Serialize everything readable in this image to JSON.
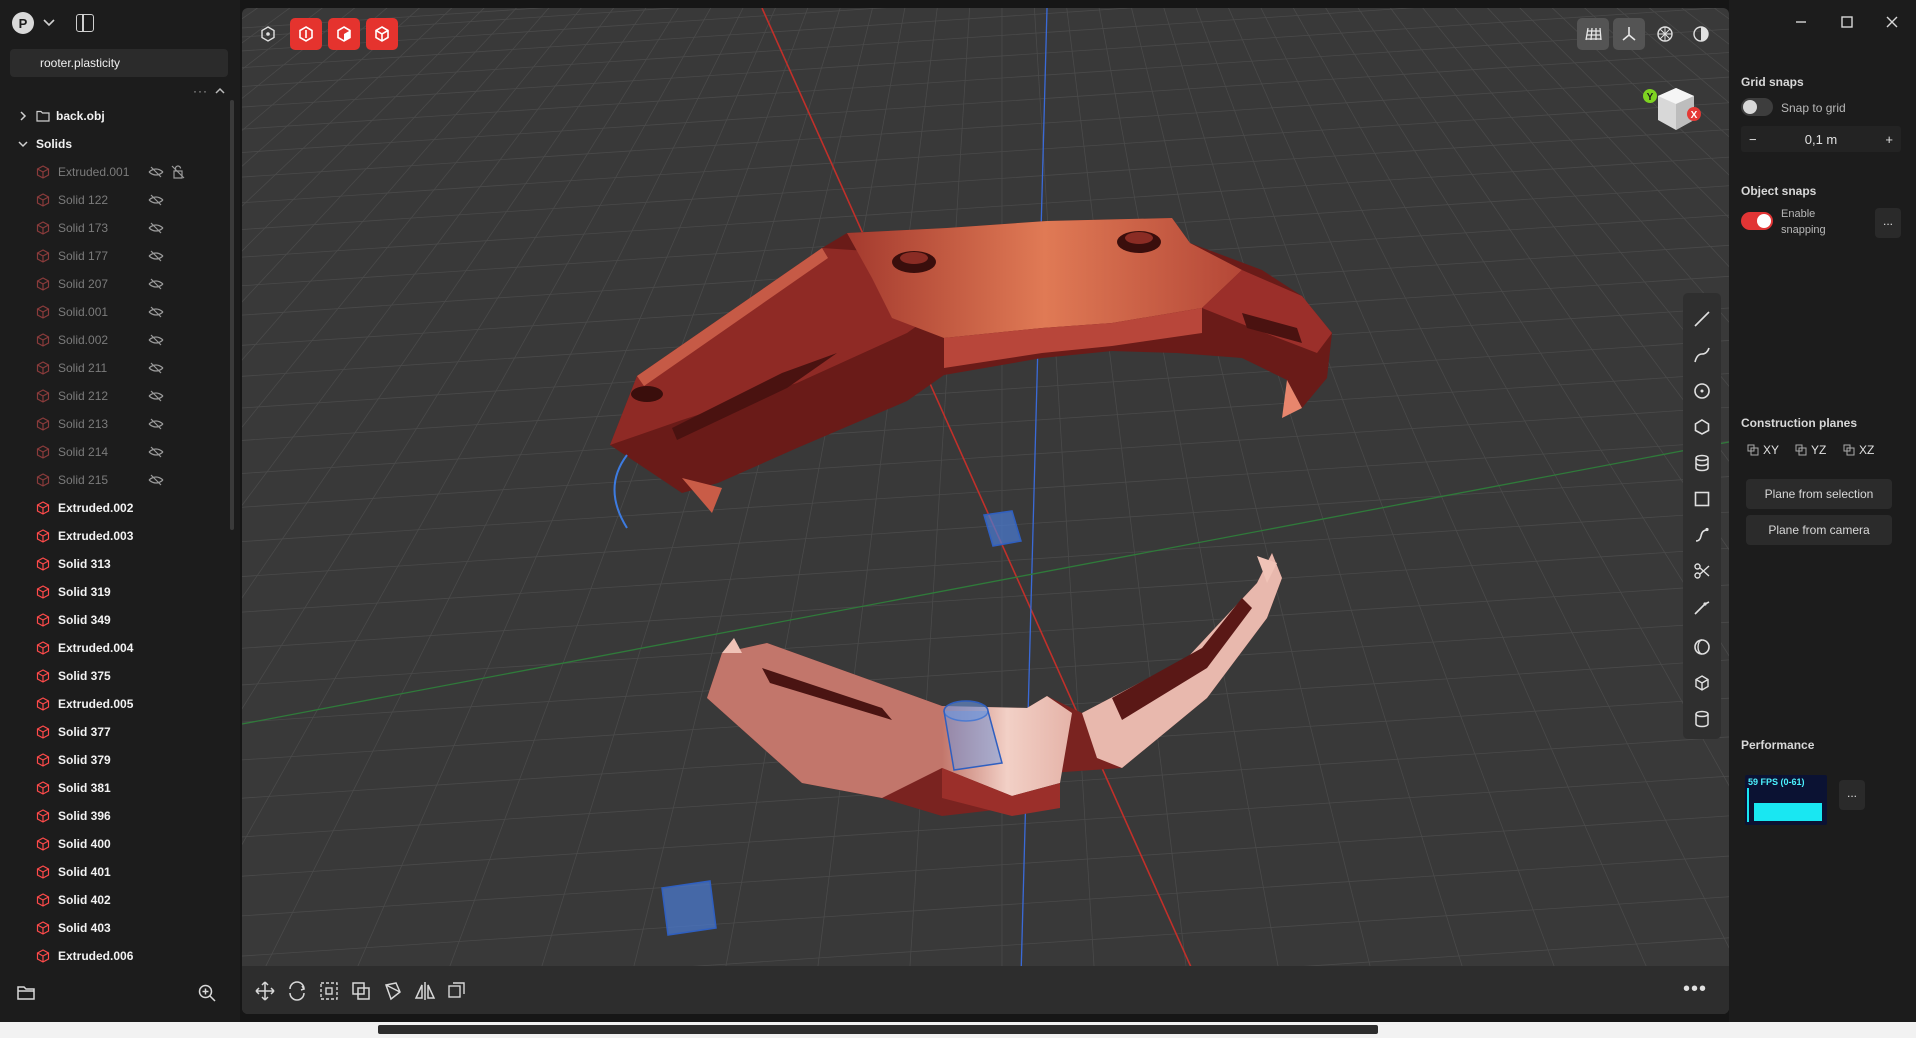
{
  "app": {
    "avatar_letter": "P",
    "file_name": "rooter.plasticity",
    "tree_more": "···"
  },
  "outliner": {
    "items": [
      {
        "label": "back.obj",
        "kind": "folder"
      },
      {
        "label": "Solids",
        "kind": "group"
      },
      {
        "label": "Extruded.001",
        "kind": "hidden-locked"
      },
      {
        "label": "Solid 122",
        "kind": "hidden"
      },
      {
        "label": "Solid 173",
        "kind": "hidden"
      },
      {
        "label": "Solid 177",
        "kind": "hidden"
      },
      {
        "label": "Solid 207",
        "kind": "hidden"
      },
      {
        "label": "Solid.001",
        "kind": "hidden"
      },
      {
        "label": "Solid.002",
        "kind": "hidden"
      },
      {
        "label": "Solid 211",
        "kind": "hidden"
      },
      {
        "label": "Solid 212",
        "kind": "hidden"
      },
      {
        "label": "Solid 213",
        "kind": "hidden"
      },
      {
        "label": "Solid 214",
        "kind": "hidden"
      },
      {
        "label": "Solid 215",
        "kind": "hidden"
      },
      {
        "label": "Extruded.002",
        "kind": "visible"
      },
      {
        "label": "Extruded.003",
        "kind": "visible"
      },
      {
        "label": "Solid 313",
        "kind": "visible"
      },
      {
        "label": "Solid 319",
        "kind": "visible"
      },
      {
        "label": "Solid 349",
        "kind": "visible"
      },
      {
        "label": "Extruded.004",
        "kind": "visible"
      },
      {
        "label": "Solid 375",
        "kind": "visible"
      },
      {
        "label": "Extruded.005",
        "kind": "visible"
      },
      {
        "label": "Solid 377",
        "kind": "visible"
      },
      {
        "label": "Solid 379",
        "kind": "visible"
      },
      {
        "label": "Solid 381",
        "kind": "visible"
      },
      {
        "label": "Solid 396",
        "kind": "visible"
      },
      {
        "label": "Solid 400",
        "kind": "visible"
      },
      {
        "label": "Solid 401",
        "kind": "visible"
      },
      {
        "label": "Solid 402",
        "kind": "visible"
      },
      {
        "label": "Solid 403",
        "kind": "visible"
      },
      {
        "label": "Extruded.006",
        "kind": "visible"
      }
    ]
  },
  "viewport": {
    "navcube": {
      "y_label": "Y",
      "x_label": "X"
    },
    "colors": {
      "accent": "#e5332e",
      "background": "#393939",
      "x_axis": "#c0302a",
      "y_axis": "#3a6ad8",
      "grid_green": "#2f7a3a",
      "selection": "#3d7be0"
    }
  },
  "right_panel": {
    "grid_snaps": {
      "title": "Grid snaps",
      "snap_to_grid_label": "Snap to grid",
      "snap_to_grid_on": false,
      "step_minus": "−",
      "step_value": "0,1 m",
      "step_plus": "+"
    },
    "object_snaps": {
      "title": "Object snaps",
      "enable_label_1": "Enable",
      "enable_label_2": "snapping",
      "enabled": true,
      "more": "..."
    },
    "construction_planes": {
      "title": "Construction planes",
      "planes": [
        "XY",
        "YZ",
        "XZ"
      ],
      "from_selection": "Plane from selection",
      "from_camera": "Plane from camera"
    },
    "performance": {
      "title": "Performance",
      "fps_text": "59 FPS (0-61)",
      "more": "..."
    }
  }
}
